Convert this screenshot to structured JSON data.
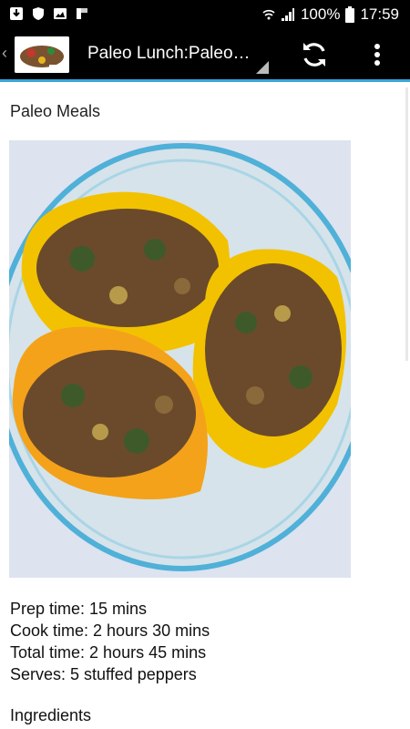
{
  "status_bar": {
    "battery": "100%",
    "time": "17:59"
  },
  "app_bar": {
    "title": "Paleo Lunch:Paleo…"
  },
  "content": {
    "section_title": "Paleo Meals",
    "prep_time": "Prep time:  15 mins",
    "cook_time": "Cook time:  2 hours 30 mins",
    "total_time": "Total time:  2 hours 45 mins",
    "serves": "Serves: 5 stuffed peppers",
    "ingredients_heading": "Ingredients"
  },
  "colors": {
    "accent": "#3aa6d8",
    "appbar": "#000000",
    "pepper_yellow": "#f2c200",
    "meat_brown": "#6b4a2b",
    "bowl_blue": "#4fb0d8"
  }
}
